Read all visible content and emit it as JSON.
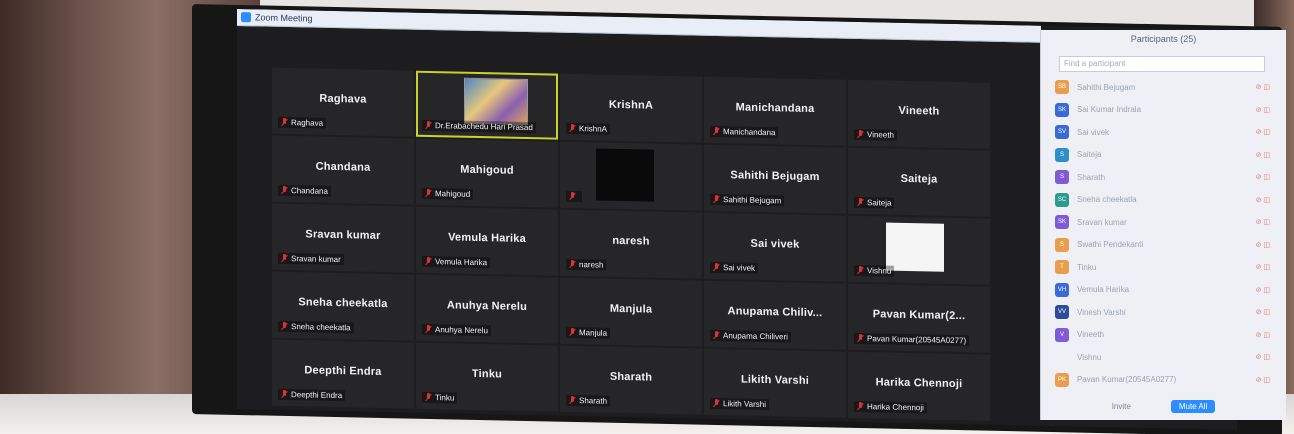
{
  "window": {
    "title": "Zoom Meeting"
  },
  "tiles": [
    {
      "name": "Raghava",
      "label": "Raghava"
    },
    {
      "name": "",
      "label": "Dr.Erabachedu Hari Prasad",
      "video": "photo",
      "active": true
    },
    {
      "name": "KrishnA",
      "label": "KrishnA"
    },
    {
      "name": "Manichandana",
      "label": "Manichandana"
    },
    {
      "name": "Vineeth",
      "label": "Vineeth"
    },
    {
      "name": "Chandana",
      "label": "Chandana"
    },
    {
      "name": "Mahigoud",
      "label": "Mahigoud"
    },
    {
      "name": "",
      "label": "",
      "video": "dark"
    },
    {
      "name": "Sahithi Bejugam",
      "label": "Sahithi Bejugam"
    },
    {
      "name": "Saiteja",
      "label": "Saiteja"
    },
    {
      "name": "Sravan kumar",
      "label": "Sravan kumar"
    },
    {
      "name": "Vemula Harika",
      "label": "Vemula Harika"
    },
    {
      "name": "naresh",
      "label": "naresh"
    },
    {
      "name": "Sai vivek",
      "label": "Sai vivek"
    },
    {
      "name": "",
      "label": "Vishnu",
      "video": "white"
    },
    {
      "name": "Sneha cheekatla",
      "label": "Sneha cheekatla"
    },
    {
      "name": "Anuhya Nerelu",
      "label": "Anuhya Nerelu"
    },
    {
      "name": "Manjula",
      "label": "Manjula"
    },
    {
      "name": "Anupama Chiliv...",
      "label": "Anupama Chiliveri"
    },
    {
      "name": "Pavan Kumar(2...",
      "label": "Pavan Kumar(20545A0277)"
    },
    {
      "name": "Deepthi Endra",
      "label": "Deepthi Endra"
    },
    {
      "name": "Tinku",
      "label": "Tinku"
    },
    {
      "name": "Sharath",
      "label": "Sharath"
    },
    {
      "name": "Likith Varshi",
      "label": "Likith Varshi"
    },
    {
      "name": "Harika Chennoji",
      "label": "Harika Chennoji"
    }
  ],
  "participants_panel": {
    "title": "Participants (25)",
    "search_placeholder": "Find a participant",
    "items": [
      {
        "initials": "SB",
        "name": "Sahithi Bejugam",
        "color": "#e89e4c"
      },
      {
        "initials": "SK",
        "name": "Sai Kumar Indrala",
        "color": "#3a6ad6"
      },
      {
        "initials": "SV",
        "name": "Sai vivek",
        "color": "#3a6ad6"
      },
      {
        "initials": "S",
        "name": "Saiteja",
        "color": "#2e8fc9"
      },
      {
        "initials": "S",
        "name": "Sharath",
        "color": "#7f5cd6"
      },
      {
        "initials": "SC",
        "name": "Sneha cheekatla",
        "color": "#2a9c8e"
      },
      {
        "initials": "SK",
        "name": "Sravan kumar",
        "color": "#7f5cd6"
      },
      {
        "initials": "S",
        "name": "Swathi Pendekanti",
        "color": "#e89e4c"
      },
      {
        "initials": "T",
        "name": "Tinku",
        "color": "#e89e4c"
      },
      {
        "initials": "VH",
        "name": "Vemula Harika",
        "color": "#3a6ad6"
      },
      {
        "initials": "VV",
        "name": "Vinesh Varshi",
        "color": "#2d4d99"
      },
      {
        "initials": "V",
        "name": "Vineeth",
        "color": "#7f5cd6"
      },
      {
        "initials": "",
        "name": "Vishnu",
        "color": "#eef0f5"
      },
      {
        "initials": "PK",
        "name": "Pavan Kumar(20545A0277)",
        "color": "#e89e4c"
      }
    ],
    "footer": {
      "invite_label": "Invite",
      "mute_all_label": "Mute All"
    }
  }
}
